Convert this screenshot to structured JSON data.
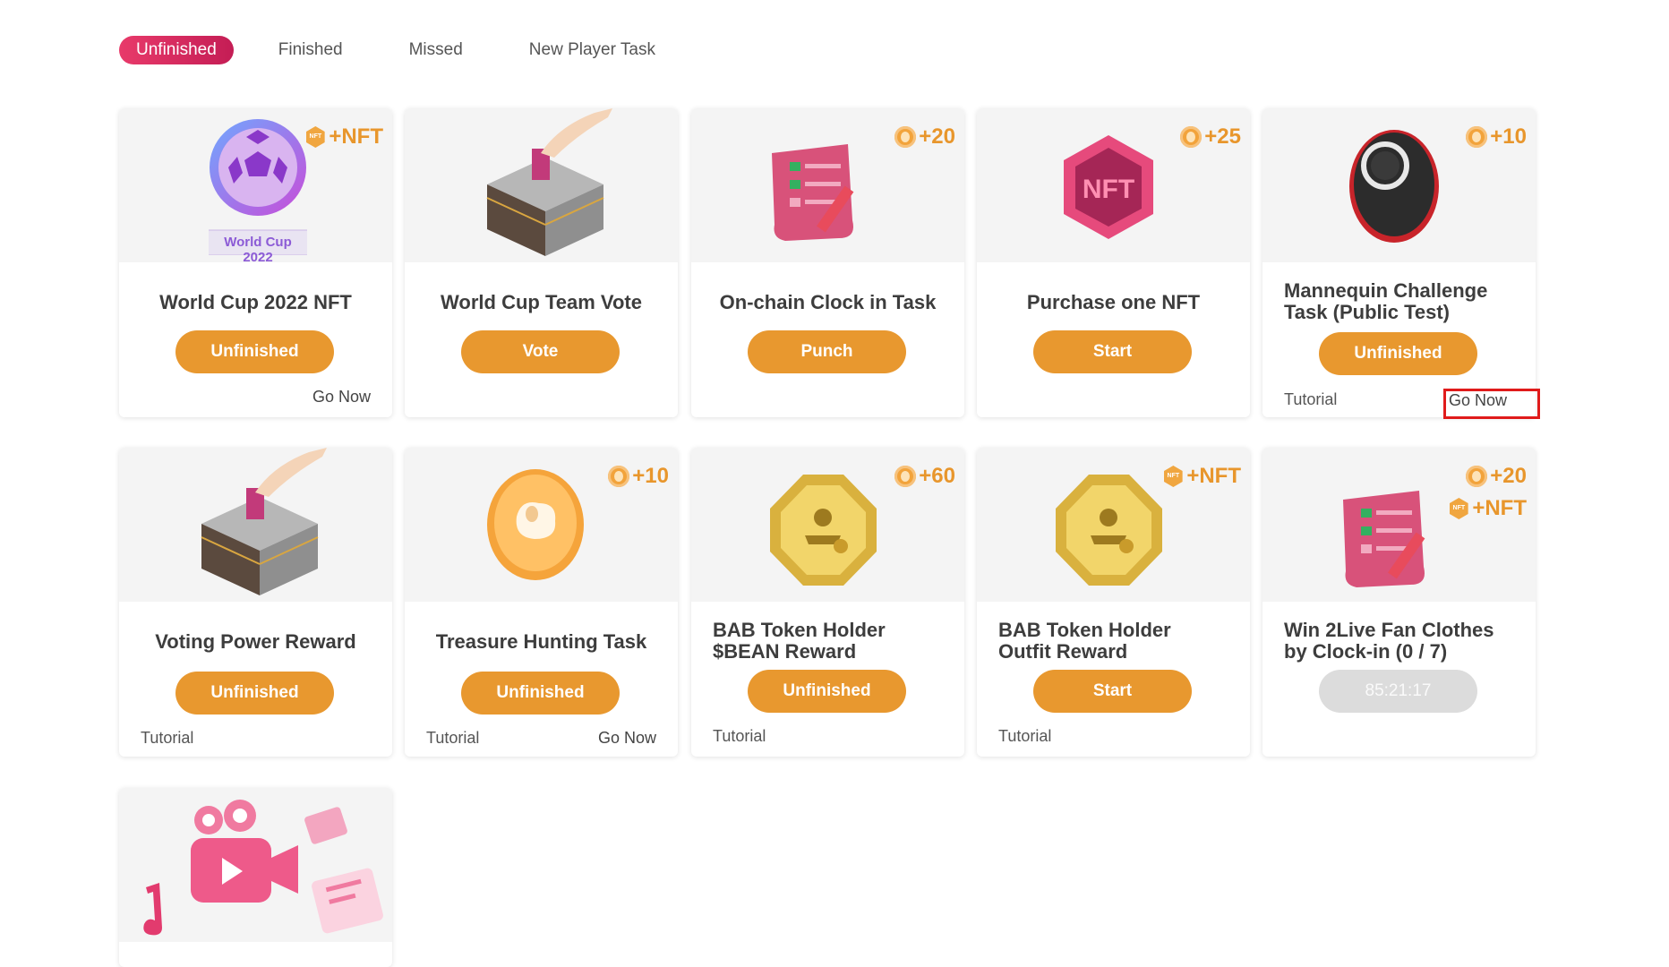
{
  "tabs": [
    {
      "label": "Unfinished",
      "active": true
    },
    {
      "label": "Finished",
      "active": false
    },
    {
      "label": "Missed",
      "active": false
    },
    {
      "label": "New Player Task",
      "active": false
    }
  ],
  "colors": {
    "accent": "#e8982f",
    "tab_active": "#d72a5f",
    "disabled": "#dcdcdc",
    "highlight": "#e01b1b"
  },
  "cards": [
    {
      "title": "World Cup 2022 NFT",
      "reward": "+NFT",
      "reward_icon": "nft-hex-icon",
      "button": "Unfinished",
      "tutorial": "",
      "go": "Go Now",
      "image": "soccer-ball",
      "image_caption": "World Cup 2022"
    },
    {
      "title": "World Cup Team Vote",
      "reward": "",
      "reward_icon": "",
      "button": "Vote",
      "tutorial": "",
      "go": "",
      "image": "ballot-box"
    },
    {
      "title": "On-chain Clock in Task",
      "reward": "+20",
      "reward_icon": "coin-icon",
      "button": "Punch",
      "tutorial": "",
      "go": "",
      "image": "checklist-scroll"
    },
    {
      "title": "Purchase one NFT",
      "reward": "+25",
      "reward_icon": "coin-icon",
      "button": "Start",
      "tutorial": "",
      "go": "",
      "image": "nft-hexagon"
    },
    {
      "title": "Mannequin Challenge Task (Public Test)",
      "reward": "+10",
      "reward_icon": "coin-icon",
      "button": "Unfinished",
      "tutorial": "Tutorial",
      "go": "Go Now",
      "image": "mask"
    },
    {
      "title": "Voting Power Reward",
      "reward": "",
      "reward_icon": "",
      "button": "Unfinished",
      "tutorial": "Tutorial",
      "go": "",
      "image": "ballot-box"
    },
    {
      "title": "Treasure Hunting Task",
      "reward": "+10",
      "reward_icon": "coin-icon",
      "button": "Unfinished",
      "tutorial": "Tutorial",
      "go": "Go Now",
      "image": "bean-coin"
    },
    {
      "title": "BAB Token Holder $BEAN Reward",
      "reward": "+60",
      "reward_icon": "coin-icon",
      "button": "Unfinished",
      "tutorial": "Tutorial",
      "go": "",
      "image": "gold-badge"
    },
    {
      "title": "BAB Token Holder Outfit Reward",
      "reward": "+NFT",
      "reward_icon": "nft-hex-icon",
      "button": "Start",
      "tutorial": "Tutorial",
      "go": "",
      "image": "gold-badge"
    },
    {
      "title": "Win 2Live Fan Clothes by Clock-in (0 / 7)",
      "reward": "+20",
      "reward2": "+NFT",
      "reward_icon": "coin-icon",
      "button": "85:21:17",
      "button_disabled": true,
      "tutorial": "",
      "go": "",
      "image": "checklist-scroll"
    },
    {
      "title": "",
      "reward": "",
      "reward_icon": "",
      "button": "",
      "tutorial": "",
      "go": "",
      "image": "video-camera"
    }
  ]
}
